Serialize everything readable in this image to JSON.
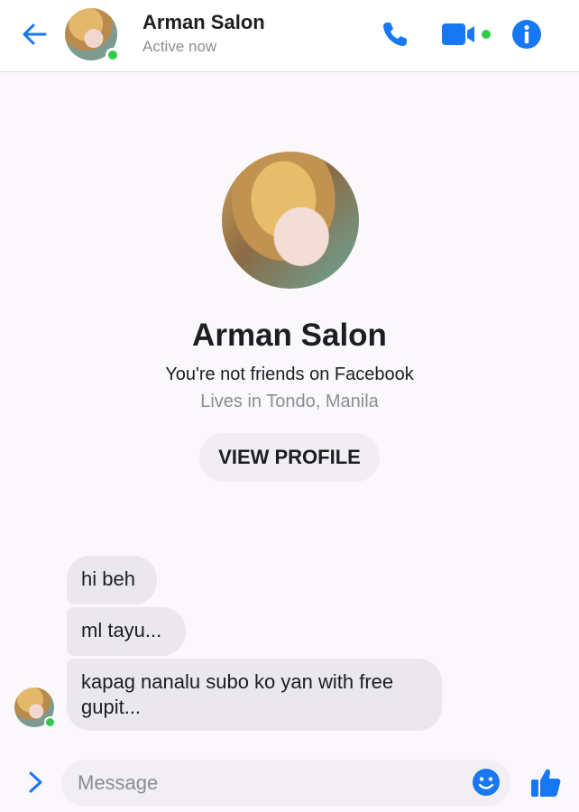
{
  "header": {
    "contact_name": "Arman Salon",
    "status": "Active now",
    "icons": [
      "back-arrow-icon",
      "phone-icon",
      "video-camera-icon",
      "info-icon"
    ]
  },
  "profile": {
    "name": "Arman Salon",
    "friend_status": "You're not friends on Facebook",
    "location": "Lives in Tondo, Manila",
    "view_profile_label": "VIEW PROFILE"
  },
  "messages": [
    {
      "text": "hi beh"
    },
    {
      "text": "ml tayu..."
    },
    {
      "text": "kapag nanalu subo ko yan with free gupit..."
    }
  ],
  "composer": {
    "placeholder": "Message",
    "icons": [
      "chevron-right-icon",
      "emoji-icon",
      "thumbs-up-icon"
    ]
  },
  "colors": {
    "accent": "#1877f2",
    "online": "#31cc46",
    "bubble": "#ebe8eb",
    "background": "#fbf8fb"
  }
}
